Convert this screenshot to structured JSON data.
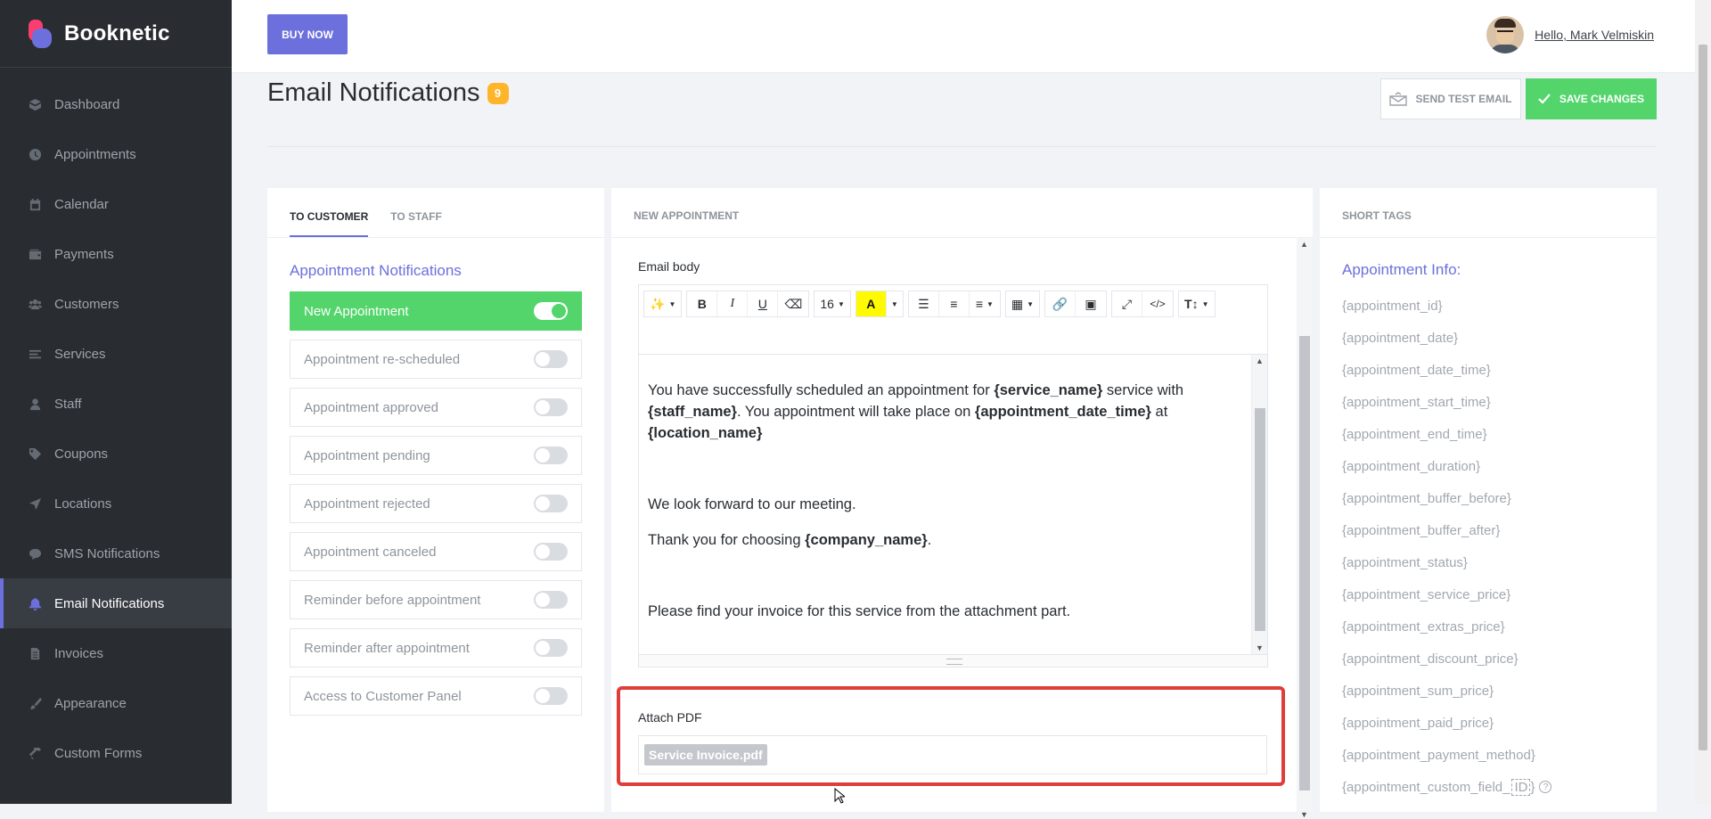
{
  "brand": {
    "name": "Booknetic"
  },
  "sidebar": {
    "items": [
      {
        "label": "Dashboard",
        "icon": "dashboard-icon"
      },
      {
        "label": "Appointments",
        "icon": "clock-icon"
      },
      {
        "label": "Calendar",
        "icon": "calendar-icon"
      },
      {
        "label": "Payments",
        "icon": "wallet-icon"
      },
      {
        "label": "Customers",
        "icon": "users-icon"
      },
      {
        "label": "Services",
        "icon": "list-icon"
      },
      {
        "label": "Staff",
        "icon": "user-icon"
      },
      {
        "label": "Coupons",
        "icon": "tag-icon"
      },
      {
        "label": "Locations",
        "icon": "location-arrow-icon"
      },
      {
        "label": "SMS Notifications",
        "icon": "chat-icon"
      },
      {
        "label": "Email Notifications",
        "icon": "bell-icon",
        "active": true
      },
      {
        "label": "Invoices",
        "icon": "file-icon"
      },
      {
        "label": "Appearance",
        "icon": "brush-icon"
      },
      {
        "label": "Custom Forms",
        "icon": "hammer-icon"
      }
    ]
  },
  "topbar": {
    "buy_now": "BUY NOW",
    "greeting": "Hello, Mark Velmiskin"
  },
  "page": {
    "title": "Email Notifications",
    "badge": "9",
    "send_test_label": "SEND TEST EMAIL",
    "save_label": "SAVE CHANGES"
  },
  "left_panel": {
    "tabs": [
      "TO CUSTOMER",
      "TO STAFF"
    ],
    "section_title": "Appointment Notifications",
    "notifications": [
      {
        "label": "New Appointment",
        "enabled": true
      },
      {
        "label": "Appointment re-scheduled",
        "enabled": false
      },
      {
        "label": "Appointment approved",
        "enabled": false
      },
      {
        "label": "Appointment pending",
        "enabled": false
      },
      {
        "label": "Appointment rejected",
        "enabled": false
      },
      {
        "label": "Appointment canceled",
        "enabled": false
      },
      {
        "label": "Reminder before appointment",
        "enabled": false
      },
      {
        "label": "Reminder after appointment",
        "enabled": false
      },
      {
        "label": "Access to Customer Panel",
        "enabled": false
      }
    ]
  },
  "mid_panel": {
    "header": "NEW APPOINTMENT",
    "email_body_label": "Email body",
    "font_size": "16",
    "body": {
      "p1_a": "You have successfully scheduled an appointment for ",
      "p1_b": "{service_name}",
      "p1_c": " service with ",
      "p1_d": "{staff_name}",
      "p1_e": ". You appointment will take place on ",
      "p1_f": "{appointment_date_time}",
      "p1_g": " at ",
      "p1_h": "{location_name}",
      "p2": "We look forward to our meeting.",
      "p3_a": "Thank you for choosing ",
      "p3_b": "{company_name}",
      "p3_c": ".",
      "p4": "Please find your invoice for this service from the attachment part."
    },
    "attach_label": "Attach PDF",
    "attachment": "Service Invoice.pdf"
  },
  "right_panel": {
    "header": "SHORT TAGS",
    "section_title": "Appointment Info:",
    "tags": [
      "{appointment_id}",
      "{appointment_date}",
      "{appointment_date_time}",
      "{appointment_start_time}",
      "{appointment_end_time}",
      "{appointment_duration}",
      "{appointment_buffer_before}",
      "{appointment_buffer_after}",
      "{appointment_status}",
      "{appointment_service_price}",
      "{appointment_extras_price}",
      "{appointment_discount_price}",
      "{appointment_sum_price}",
      "{appointment_paid_price}",
      "{appointment_payment_method}"
    ],
    "custom_tag_prefix": "{appointment_custom_field_",
    "custom_tag_id": "ID",
    "custom_tag_suffix": "}"
  },
  "colors": {
    "accent": "#6c70dc",
    "success": "#53d56c",
    "sidebar": "#292d32",
    "badge": "#ffb52a",
    "highlight": "#e03c3c"
  }
}
